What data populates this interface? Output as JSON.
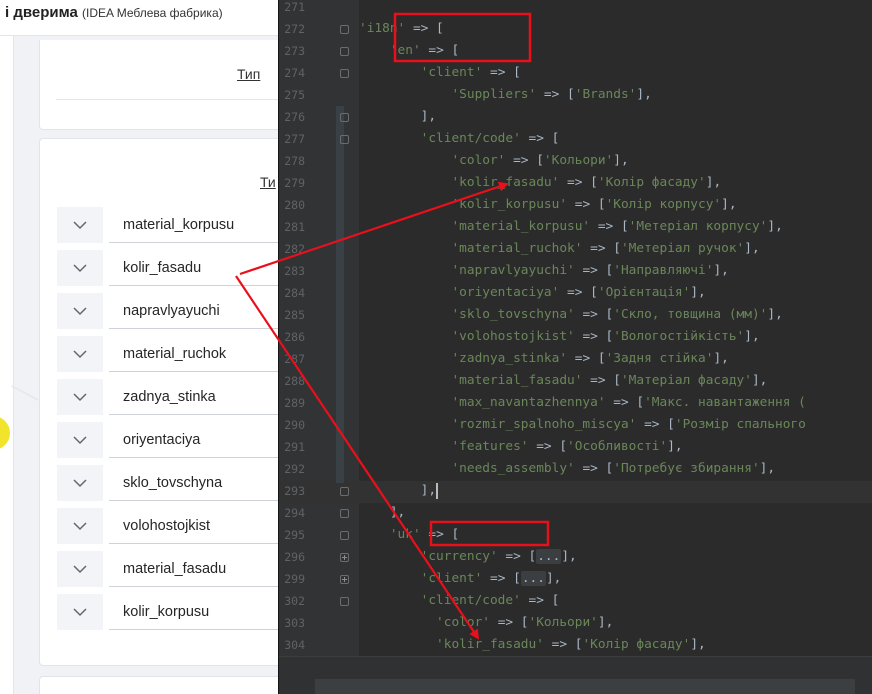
{
  "app": {
    "title": "і дверима",
    "subtitle": "(IDEA Меблева фабрика)"
  },
  "card_top": {
    "type_label": "Тип"
  },
  "card_main": {
    "type_label": "Ти",
    "fields": [
      "material_korpusu",
      "kolir_fasadu",
      "napravlyayuchi",
      "material_ruchok",
      "zadnya_stinka",
      "oriyentaciya",
      "sklo_tovschyna",
      "volohostojkist",
      "material_fasadu",
      "kolir_korpusu"
    ]
  },
  "editor": {
    "lines": [
      {
        "n": "271",
        "fold": "",
        "html": ""
      },
      {
        "n": "272",
        "fold": "open",
        "html": "<span class='str'>'i18n'</span> => ["
      },
      {
        "n": "273",
        "fold": "open",
        "html": "    <span class='str'>'en'</span> => ["
      },
      {
        "n": "274",
        "fold": "open",
        "html": "        <span class='str'>'client'</span> => ["
      },
      {
        "n": "275",
        "fold": "",
        "html": "            <span class='str'>'Suppliers'</span> => [<span class='str'>'Brands'</span>],"
      },
      {
        "n": "276",
        "fold": "open",
        "html": "        ],"
      },
      {
        "n": "277",
        "fold": "open",
        "html": "        <span class='str'>'client/code'</span> => ["
      },
      {
        "n": "278",
        "fold": "",
        "html": "            <span class='str'>'color'</span> => [<span class='str'>'Кольори'</span>],"
      },
      {
        "n": "279",
        "fold": "",
        "html": "            <span class='str'>'kolir_fasadu'</span> => [<span class='str'>'Колір фасаду'</span>],"
      },
      {
        "n": "280",
        "fold": "",
        "html": "            <span class='str'>'kolir_korpusu'</span> => [<span class='str'>'Колір корпусу'</span>],"
      },
      {
        "n": "281",
        "fold": "",
        "html": "            <span class='str'>'material_korpusu'</span> => [<span class='str'>'Метеріал корпусу'</span>],"
      },
      {
        "n": "282",
        "fold": "",
        "html": "            <span class='str'>'material_ruchok'</span> => [<span class='str'>'Метеріал ручок'</span>],"
      },
      {
        "n": "283",
        "fold": "",
        "html": "            <span class='str'>'napravlyayuchi'</span> => [<span class='str'>'Направляючі'</span>],"
      },
      {
        "n": "284",
        "fold": "",
        "html": "            <span class='str'>'oriyentaciya'</span> => [<span class='str'>'Орієнтація'</span>],"
      },
      {
        "n": "285",
        "fold": "",
        "html": "            <span class='str'>'sklo_tovschyna'</span> => [<span class='str'>'Скло, товщина (мм)'</span>],"
      },
      {
        "n": "286",
        "fold": "",
        "html": "            <span class='str'>'volohostojkist'</span> => [<span class='str'>'Вологостійкість'</span>],"
      },
      {
        "n": "287",
        "fold": "",
        "html": "            <span class='str'>'zadnya_stinka'</span> => [<span class='str'>'Задня стійка'</span>],"
      },
      {
        "n": "288",
        "fold": "",
        "html": "            <span class='str'>'material_fasadu'</span> => [<span class='str'>'Матеріал фасаду'</span>],"
      },
      {
        "n": "289",
        "fold": "",
        "html": "            <span class='str'>'max_navantazhennya'</span> => [<span class='str'>'Макс. навантаження (</span>"
      },
      {
        "n": "290",
        "fold": "",
        "html": "            <span class='str'>'rozmir_spalnoho_miscya'</span> => [<span class='str'>'Розмір спального</span>"
      },
      {
        "n": "291",
        "fold": "",
        "html": "            <span class='str'>'features'</span> => [<span class='str'>'Особливості'</span>],"
      },
      {
        "n": "292",
        "fold": "",
        "html": "            <span class='str'>'needs_assembly'</span> => [<span class='str'>'Потребує збирання'</span>],"
      },
      {
        "n": "293",
        "fold": "open",
        "html": "        ],<span class='cursor'></span>"
      },
      {
        "n": "294",
        "fold": "open",
        "html": "    ],"
      },
      {
        "n": "295",
        "fold": "open",
        "html": "    <span class='str'>'uk'</span> => ["
      },
      {
        "n": "296",
        "fold": "plus",
        "html": "        <span class='str'>'currency'</span> => [<span class='fold-box'>...</span>],"
      },
      {
        "n": "299",
        "fold": "plus",
        "html": "        <span class='str'>'client'</span> => [<span class='fold-box'>...</span>],"
      },
      {
        "n": "302",
        "fold": "open",
        "html": "        <span class='str'>'client/code'</span> => ["
      },
      {
        "n": "303",
        "fold": "",
        "html": "          <span class='str'>'color'</span> => [<span class='str'>'Кольори'</span>],"
      },
      {
        "n": "304",
        "fold": "",
        "html": "          <span class='str'>'kolir_fasadu'</span> => [<span class='str'>'Колір фасаду'</span>],"
      }
    ]
  },
  "colors": {
    "annotation": "#e8101b",
    "editor_bg": "#2b2b2b",
    "string": "#6a8759"
  }
}
